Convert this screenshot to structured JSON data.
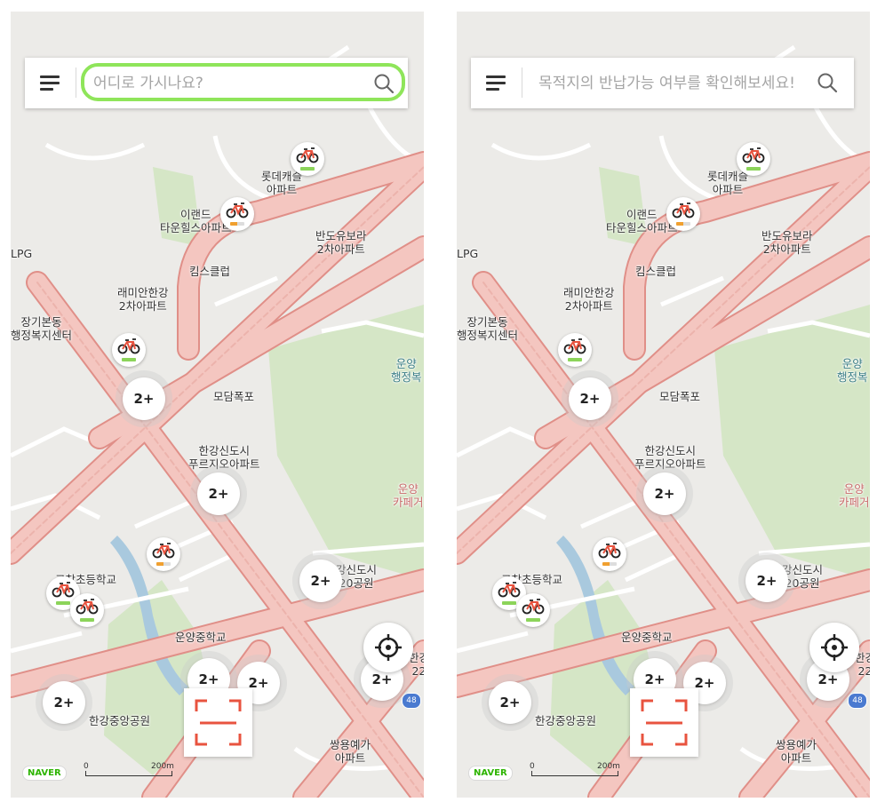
{
  "screens": [
    {
      "id": "left",
      "search": {
        "placeholder": "어디로 가시나요?",
        "active": true
      }
    },
    {
      "id": "right",
      "search": {
        "placeholder": "목적지의 반납가능 여부를 확인해보세요!",
        "active": false
      }
    }
  ],
  "map": {
    "labels": {
      "lotte_castle": "롯데캐슬\n아파트",
      "eland": "이랜드\n타운힐스아파트",
      "bando": "반도유보라\n2차아파트",
      "kims_club": "킴스클럽",
      "raemian": "래미안한강\n2차아파트",
      "janggi": "장기본동\n행정복지센터",
      "lpg": "LPG",
      "modam": "모담폭포",
      "prugio": "한강신도시\n푸르지오아파트",
      "unyang_admin": "운양\n행정복",
      "unyang_cafe": "운양\n카페거",
      "park20": "강신도시\n20공원",
      "elementary": "고창초등학교",
      "middle": "운양중학교",
      "central_park": "한강중앙공원",
      "ssangyong": "쌍용예가\n아파트",
      "han22": "한강\n22"
    },
    "cluster_label": "2+",
    "highway_number": "48",
    "naver_logo": "NAVER",
    "scale": {
      "zero": "0",
      "distance": "200m"
    },
    "colors": {
      "road_fill": "#f4c6c0",
      "road_edge": "#e08f88",
      "park": "#d5e6c6",
      "water": "#a9c9de",
      "accent": "#8fe55a",
      "scan": "#e8533f"
    }
  }
}
